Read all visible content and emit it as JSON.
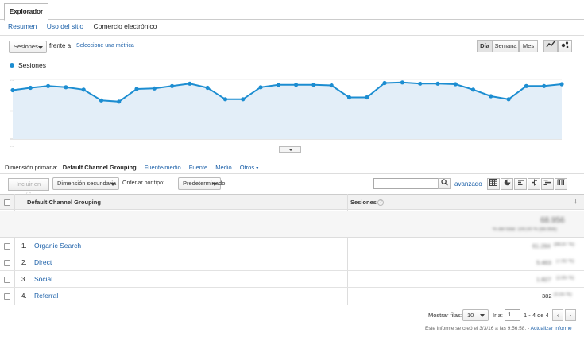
{
  "tab": {
    "title": "Explorador"
  },
  "subnav": {
    "items": [
      "Resumen",
      "Uso del sitio",
      "Comercio electrónico"
    ]
  },
  "controls": {
    "metric_select": "Sesiones",
    "versus_text": "frente a",
    "select_metric_link": "Seleccione una métrica",
    "period_buttons": [
      "Día",
      "Semana",
      "Mes"
    ],
    "active_period": "Día"
  },
  "legend": {
    "series_label": "Sesiones",
    "color": "#1c8dd1"
  },
  "chart_data": {
    "type": "area",
    "series": [
      {
        "name": "Sesiones",
        "color": "#1c8dd1",
        "values": [
          0.82,
          0.86,
          0.89,
          0.87,
          0.83,
          0.65,
          0.63,
          0.84,
          0.85,
          0.89,
          0.93,
          0.86,
          0.67,
          0.67,
          0.87,
          0.91,
          0.91,
          0.91,
          0.9,
          0.7,
          0.7,
          0.94,
          0.95,
          0.93,
          0.93,
          0.92,
          0.83,
          0.72,
          0.67,
          0.89,
          0.89,
          0.92
        ]
      }
    ],
    "ylim": [
      0,
      1
    ],
    "grid": true,
    "ytick_label_1": "...",
    "ytick_label_2": "...",
    "fill_color": "#e3eef8"
  },
  "dimension": {
    "label": "Dimensión primaria:",
    "active": "Default Channel Grouping",
    "options": [
      "Fuente/medio",
      "Fuente",
      "Medio",
      "Otros"
    ]
  },
  "table_toolbar": {
    "include_label": "Incluir en gráfico",
    "secondary_dimension": "Dimensión secundaria",
    "sort_label": "Ordenar por tipo:",
    "sort_value": "Predeterminado",
    "advanced_link": "avanzado"
  },
  "table": {
    "columns": [
      "Default Channel Grouping",
      "Sesiones"
    ],
    "total": {
      "value": "68.956",
      "sub": "% del total: 100,00 % (68.956)"
    },
    "rows": [
      {
        "num": "1.",
        "name": "Organic Search",
        "value": "61.284",
        "pct": "(88,87 %)"
      },
      {
        "num": "2.",
        "name": "Direct",
        "value": "5.463",
        "pct": "(7,92 %)"
      },
      {
        "num": "3.",
        "name": "Social",
        "value": "1.827",
        "pct": "(2,65 %)"
      },
      {
        "num": "4.",
        "name": "Referral",
        "value": "382",
        "pct": "(0,55 %)"
      }
    ]
  },
  "footer": {
    "show_rows_label": "Mostrar filas:",
    "show_rows_value": "10",
    "goto_label": "Ir a:",
    "goto_value": "1",
    "range_text": "1 - 4 de 4",
    "report_created": "Este informe se creó el 3/3/16 a las 9:56:58. -",
    "refresh_link": "Actualizar informe"
  }
}
